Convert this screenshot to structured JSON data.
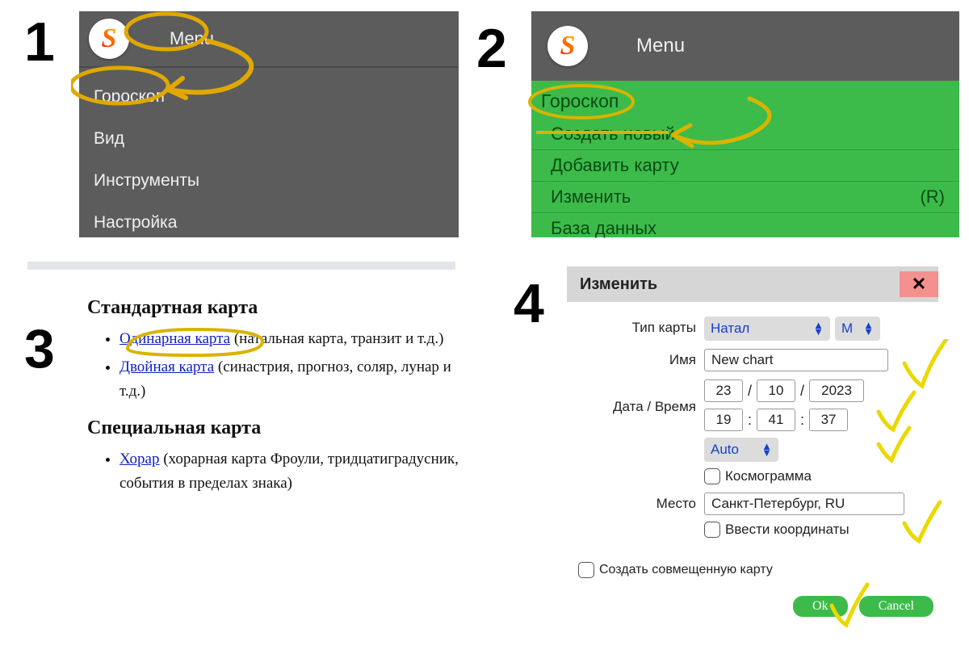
{
  "steps": {
    "s1": "1",
    "s2": "2",
    "s3": "3",
    "s4": "4"
  },
  "menu_label": "Menu",
  "panel1": {
    "items": [
      "Гороскоп",
      "Вид",
      "Инструменты",
      "Настройка"
    ]
  },
  "panel2": {
    "title": "Гороскоп",
    "items": [
      {
        "label": "Создать новый",
        "shortcut": ""
      },
      {
        "label": "Добавить карту",
        "shortcut": ""
      },
      {
        "label": "Изменить",
        "shortcut": "(R)"
      },
      {
        "label": "База данных",
        "shortcut": ""
      }
    ]
  },
  "panel3": {
    "h1": "Стандартная карта",
    "link1": "Одинарная карта",
    "desc1": " (натальная карта, транзит и т.д.)",
    "link2": "Двойная карта",
    "desc2": " (синастрия, прогноз, соляр, лунар и т.д.)",
    "h2": "Специальная карта",
    "link3": "Хорар",
    "desc3": " (хорарная карта Фроули, тридцатиградусник, события в пределах знака)"
  },
  "panel4": {
    "title": "Изменить",
    "lbl_type": "Тип карты",
    "type_val": "Натал",
    "type_m": "М",
    "lbl_name": "Имя",
    "name_val": "New chart",
    "lbl_datetime": "Дата / Время",
    "date": {
      "d": "23",
      "m": "10",
      "y": "2023"
    },
    "time": {
      "h": "19",
      "mi": "41",
      "s": "37"
    },
    "tz": "Auto",
    "chk_cosmo": "Космограмма",
    "lbl_place": "Место",
    "place_val": "Санкт-Петербург, RU",
    "chk_coords": "Ввести координаты",
    "chk_combined": "Создать совмещенную карту",
    "btn_ok": "Ok",
    "btn_cancel": "Cancel"
  }
}
